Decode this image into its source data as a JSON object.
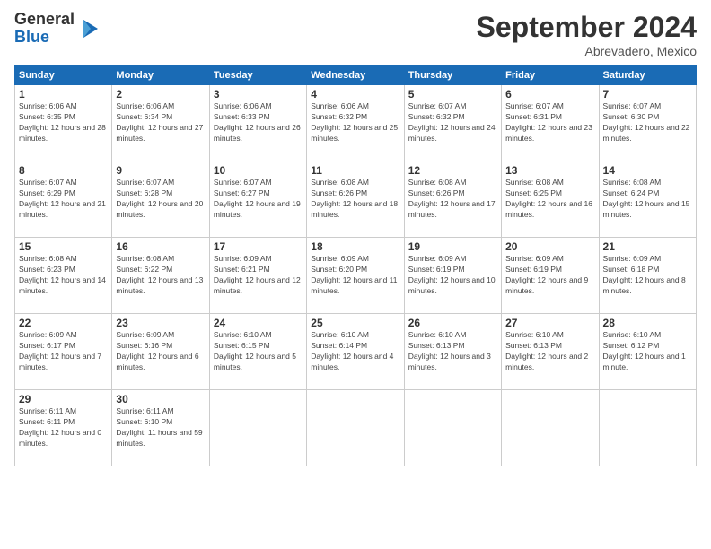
{
  "logo": {
    "general": "General",
    "blue": "Blue"
  },
  "header": {
    "month": "September 2024",
    "location": "Abrevadero, Mexico"
  },
  "days_of_week": [
    "Sunday",
    "Monday",
    "Tuesday",
    "Wednesday",
    "Thursday",
    "Friday",
    "Saturday"
  ],
  "weeks": [
    [
      {
        "day": "1",
        "sunrise": "6:06 AM",
        "sunset": "6:35 PM",
        "daylight": "12 hours and 28 minutes."
      },
      {
        "day": "2",
        "sunrise": "6:06 AM",
        "sunset": "6:34 PM",
        "daylight": "12 hours and 27 minutes."
      },
      {
        "day": "3",
        "sunrise": "6:06 AM",
        "sunset": "6:33 PM",
        "daylight": "12 hours and 26 minutes."
      },
      {
        "day": "4",
        "sunrise": "6:06 AM",
        "sunset": "6:32 PM",
        "daylight": "12 hours and 25 minutes."
      },
      {
        "day": "5",
        "sunrise": "6:07 AM",
        "sunset": "6:32 PM",
        "daylight": "12 hours and 24 minutes."
      },
      {
        "day": "6",
        "sunrise": "6:07 AM",
        "sunset": "6:31 PM",
        "daylight": "12 hours and 23 minutes."
      },
      {
        "day": "7",
        "sunrise": "6:07 AM",
        "sunset": "6:30 PM",
        "daylight": "12 hours and 22 minutes."
      }
    ],
    [
      {
        "day": "8",
        "sunrise": "6:07 AM",
        "sunset": "6:29 PM",
        "daylight": "12 hours and 21 minutes."
      },
      {
        "day": "9",
        "sunrise": "6:07 AM",
        "sunset": "6:28 PM",
        "daylight": "12 hours and 20 minutes."
      },
      {
        "day": "10",
        "sunrise": "6:07 AM",
        "sunset": "6:27 PM",
        "daylight": "12 hours and 19 minutes."
      },
      {
        "day": "11",
        "sunrise": "6:08 AM",
        "sunset": "6:26 PM",
        "daylight": "12 hours and 18 minutes."
      },
      {
        "day": "12",
        "sunrise": "6:08 AM",
        "sunset": "6:26 PM",
        "daylight": "12 hours and 17 minutes."
      },
      {
        "day": "13",
        "sunrise": "6:08 AM",
        "sunset": "6:25 PM",
        "daylight": "12 hours and 16 minutes."
      },
      {
        "day": "14",
        "sunrise": "6:08 AM",
        "sunset": "6:24 PM",
        "daylight": "12 hours and 15 minutes."
      }
    ],
    [
      {
        "day": "15",
        "sunrise": "6:08 AM",
        "sunset": "6:23 PM",
        "daylight": "12 hours and 14 minutes."
      },
      {
        "day": "16",
        "sunrise": "6:08 AM",
        "sunset": "6:22 PM",
        "daylight": "12 hours and 13 minutes."
      },
      {
        "day": "17",
        "sunrise": "6:09 AM",
        "sunset": "6:21 PM",
        "daylight": "12 hours and 12 minutes."
      },
      {
        "day": "18",
        "sunrise": "6:09 AM",
        "sunset": "6:20 PM",
        "daylight": "12 hours and 11 minutes."
      },
      {
        "day": "19",
        "sunrise": "6:09 AM",
        "sunset": "6:19 PM",
        "daylight": "12 hours and 10 minutes."
      },
      {
        "day": "20",
        "sunrise": "6:09 AM",
        "sunset": "6:19 PM",
        "daylight": "12 hours and 9 minutes."
      },
      {
        "day": "21",
        "sunrise": "6:09 AM",
        "sunset": "6:18 PM",
        "daylight": "12 hours and 8 minutes."
      }
    ],
    [
      {
        "day": "22",
        "sunrise": "6:09 AM",
        "sunset": "6:17 PM",
        "daylight": "12 hours and 7 minutes."
      },
      {
        "day": "23",
        "sunrise": "6:09 AM",
        "sunset": "6:16 PM",
        "daylight": "12 hours and 6 minutes."
      },
      {
        "day": "24",
        "sunrise": "6:10 AM",
        "sunset": "6:15 PM",
        "daylight": "12 hours and 5 minutes."
      },
      {
        "day": "25",
        "sunrise": "6:10 AM",
        "sunset": "6:14 PM",
        "daylight": "12 hours and 4 minutes."
      },
      {
        "day": "26",
        "sunrise": "6:10 AM",
        "sunset": "6:13 PM",
        "daylight": "12 hours and 3 minutes."
      },
      {
        "day": "27",
        "sunrise": "6:10 AM",
        "sunset": "6:13 PM",
        "daylight": "12 hours and 2 minutes."
      },
      {
        "day": "28",
        "sunrise": "6:10 AM",
        "sunset": "6:12 PM",
        "daylight": "12 hours and 1 minute."
      }
    ],
    [
      {
        "day": "29",
        "sunrise": "6:11 AM",
        "sunset": "6:11 PM",
        "daylight": "12 hours and 0 minutes."
      },
      {
        "day": "30",
        "sunrise": "6:11 AM",
        "sunset": "6:10 PM",
        "daylight": "11 hours and 59 minutes."
      },
      null,
      null,
      null,
      null,
      null
    ]
  ]
}
